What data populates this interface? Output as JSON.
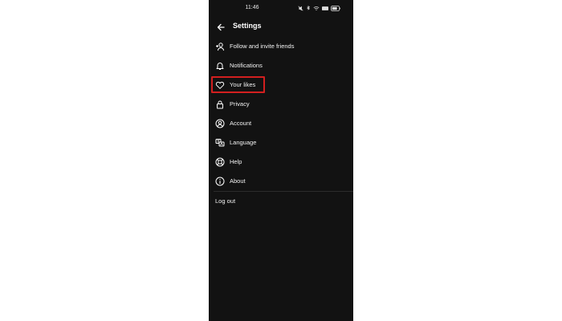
{
  "status_bar": {
    "time": "11:46",
    "icons": [
      "mute-icon",
      "bluetooth-icon",
      "wifi-icon",
      "signal-icon",
      "battery-icon"
    ]
  },
  "header": {
    "back_icon": "arrow-left-icon",
    "title": "Settings"
  },
  "menu": {
    "items": [
      {
        "label": "Follow and invite friends",
        "icon": "add-person-icon"
      },
      {
        "label": "Notifications",
        "icon": "bell-icon"
      },
      {
        "label": "Your likes",
        "icon": "heart-icon",
        "highlighted": true
      },
      {
        "label": "Privacy",
        "icon": "lock-icon"
      },
      {
        "label": "Account",
        "icon": "user-circle-icon"
      },
      {
        "label": "Language",
        "icon": "language-icon"
      },
      {
        "label": "Help",
        "icon": "lifebuoy-icon"
      },
      {
        "label": "About",
        "icon": "info-icon"
      }
    ]
  },
  "logout": {
    "label": "Log out"
  },
  "colors": {
    "background": "#121212",
    "text": "#ffffff",
    "highlight": "#d21f1f",
    "page_background": "#ffffff"
  }
}
